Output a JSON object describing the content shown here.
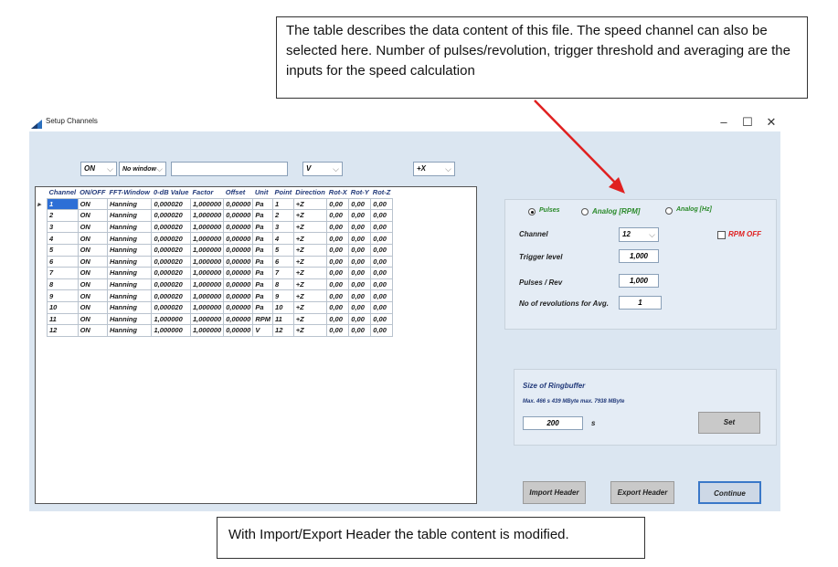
{
  "callouts": {
    "top": "The table describes the data content of this file. The speed channel can also be selected here.  Number of pulses/revolution, trigger threshold and averaging are the inputs for the speed calculation",
    "bottom": "With Import/Export Header the table content is modified."
  },
  "window": {
    "title": "Setup Channels",
    "minimize": "–",
    "maximize": "☐",
    "close": "✕"
  },
  "toolbar": {
    "onoff_value": "ON",
    "window_value": "No window",
    "text_value": "",
    "unit_value": "V",
    "direction_value": "+X"
  },
  "grid": {
    "headers": [
      "Channel",
      "ON/OFF",
      "FFT-Window",
      "0-dB Value",
      "Factor",
      "Offset",
      "Unit",
      "Point",
      "Direction",
      "Rot-X",
      "Rot-Y",
      "Rot-Z"
    ],
    "rows": [
      [
        "1",
        "ON",
        "Hanning",
        "0,000020",
        "1,000000",
        "0,00000",
        "Pa",
        "1",
        "+Z",
        "0,00",
        "0,00",
        "0,00"
      ],
      [
        "2",
        "ON",
        "Hanning",
        "0,000020",
        "1,000000",
        "0,00000",
        "Pa",
        "2",
        "+Z",
        "0,00",
        "0,00",
        "0,00"
      ],
      [
        "3",
        "ON",
        "Hanning",
        "0,000020",
        "1,000000",
        "0,00000",
        "Pa",
        "3",
        "+Z",
        "0,00",
        "0,00",
        "0,00"
      ],
      [
        "4",
        "ON",
        "Hanning",
        "0,000020",
        "1,000000",
        "0,00000",
        "Pa",
        "4",
        "+Z",
        "0,00",
        "0,00",
        "0,00"
      ],
      [
        "5",
        "ON",
        "Hanning",
        "0,000020",
        "1,000000",
        "0,00000",
        "Pa",
        "5",
        "+Z",
        "0,00",
        "0,00",
        "0,00"
      ],
      [
        "6",
        "ON",
        "Hanning",
        "0,000020",
        "1,000000",
        "0,00000",
        "Pa",
        "6",
        "+Z",
        "0,00",
        "0,00",
        "0,00"
      ],
      [
        "7",
        "ON",
        "Hanning",
        "0,000020",
        "1,000000",
        "0,00000",
        "Pa",
        "7",
        "+Z",
        "0,00",
        "0,00",
        "0,00"
      ],
      [
        "8",
        "ON",
        "Hanning",
        "0,000020",
        "1,000000",
        "0,00000",
        "Pa",
        "8",
        "+Z",
        "0,00",
        "0,00",
        "0,00"
      ],
      [
        "9",
        "ON",
        "Hanning",
        "0,000020",
        "1,000000",
        "0,00000",
        "Pa",
        "9",
        "+Z",
        "0,00",
        "0,00",
        "0,00"
      ],
      [
        "10",
        "ON",
        "Hanning",
        "0,000020",
        "1,000000",
        "0,00000",
        "Pa",
        "10",
        "+Z",
        "0,00",
        "0,00",
        "0,00"
      ],
      [
        "11",
        "ON",
        "Hanning",
        "1,000000",
        "1,000000",
        "0,00000",
        "RPM",
        "11",
        "+Z",
        "0,00",
        "0,00",
        "0,00"
      ],
      [
        "12",
        "ON",
        "Hanning",
        "1,000000",
        "1,000000",
        "0,00000",
        "V",
        "12",
        "+Z",
        "0,00",
        "0,00",
        "0,00"
      ]
    ],
    "current_row_marker": "▸"
  },
  "speed": {
    "radio_pulses": "Pulses",
    "radio_analog_rpm": "Analog [RPM]",
    "radio_analog_hz": "Analog [Hz]",
    "channel_label": "Channel",
    "channel_value": "12",
    "rpm_off_label": "RPM OFF",
    "trigger_label": "Trigger level",
    "trigger_value": "1,000",
    "pulses_label": "Pulses / Rev",
    "pulses_value": "1,000",
    "revs_label": "No of revolutions for Avg.",
    "revs_value": "1"
  },
  "ringbuffer": {
    "title": "Size of Ringbuffer",
    "info": "Max. 466 s  439 MByte  max. 7938 MByte",
    "value": "200",
    "unit": "s",
    "set_label": "Set"
  },
  "footer": {
    "import_label": "Import Header",
    "export_label": "Export Header",
    "continue_label": "Continue"
  },
  "colors": {
    "client_bg": "#dbe6f1",
    "arrow": "#e02020",
    "selected_cell": "#2d6fd6",
    "header_text": "#223a7a",
    "rpm_off": "#e02020",
    "analog_text": "#2a8a2a"
  }
}
